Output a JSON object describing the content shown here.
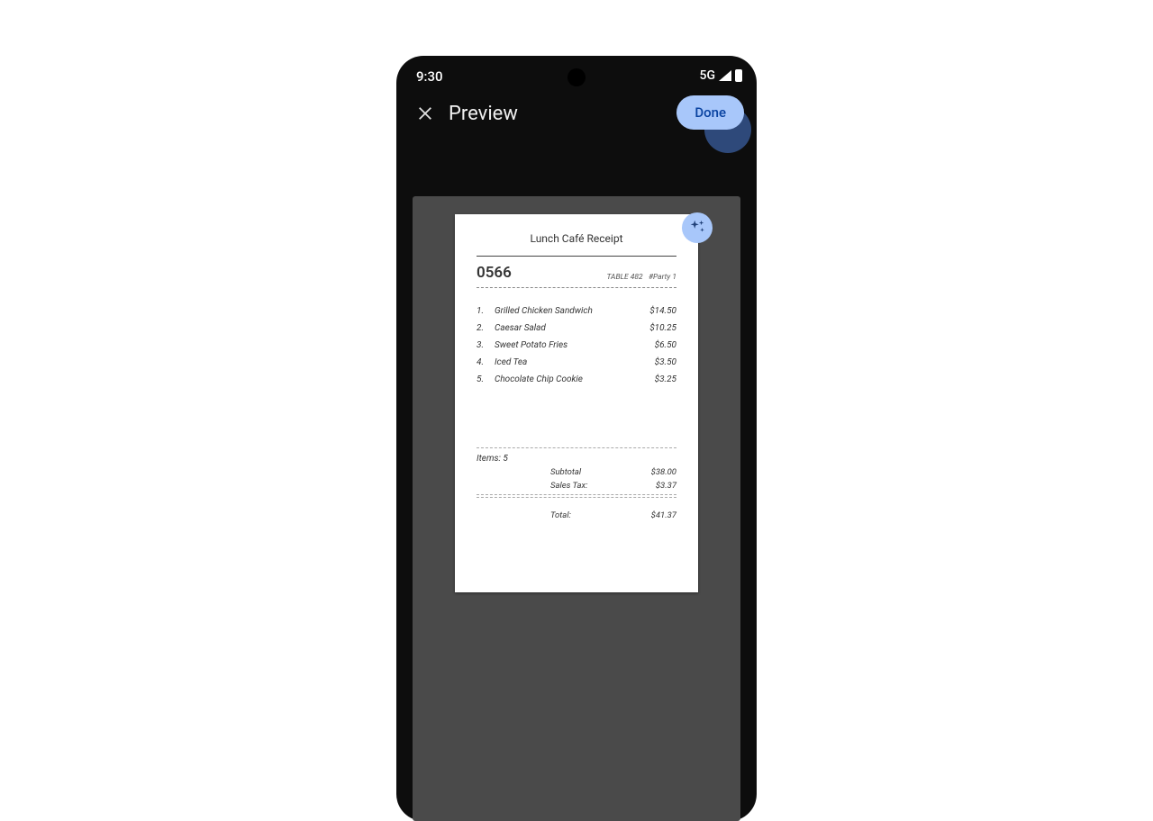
{
  "status": {
    "time": "9:30",
    "network": "5G"
  },
  "header": {
    "title": "Preview",
    "done": "Done"
  },
  "receipt": {
    "title": "Lunch Café Receipt",
    "number": "0566",
    "table_label": "TABLE  482",
    "party_label": "#Party 1",
    "lines": [
      {
        "n": "1.",
        "name": "Grilled Chicken Sandwich",
        "price": "$14.50"
      },
      {
        "n": "2.",
        "name": "Caesar Salad",
        "price": "$10.25"
      },
      {
        "n": "3.",
        "name": "Sweet Potato Fries",
        "price": "$6.50"
      },
      {
        "n": "4.",
        "name": "Iced Tea",
        "price": "$3.50"
      },
      {
        "n": "5.",
        "name": "Chocolate Chip Cookie",
        "price": "$3.25"
      }
    ],
    "items_count": "Items: 5",
    "subtotal_label": "Subtotal",
    "subtotal": "$38.00",
    "tax_label": "Sales Tax:",
    "tax": "$3.37",
    "total_label": "Total:",
    "total": "$41.37"
  }
}
